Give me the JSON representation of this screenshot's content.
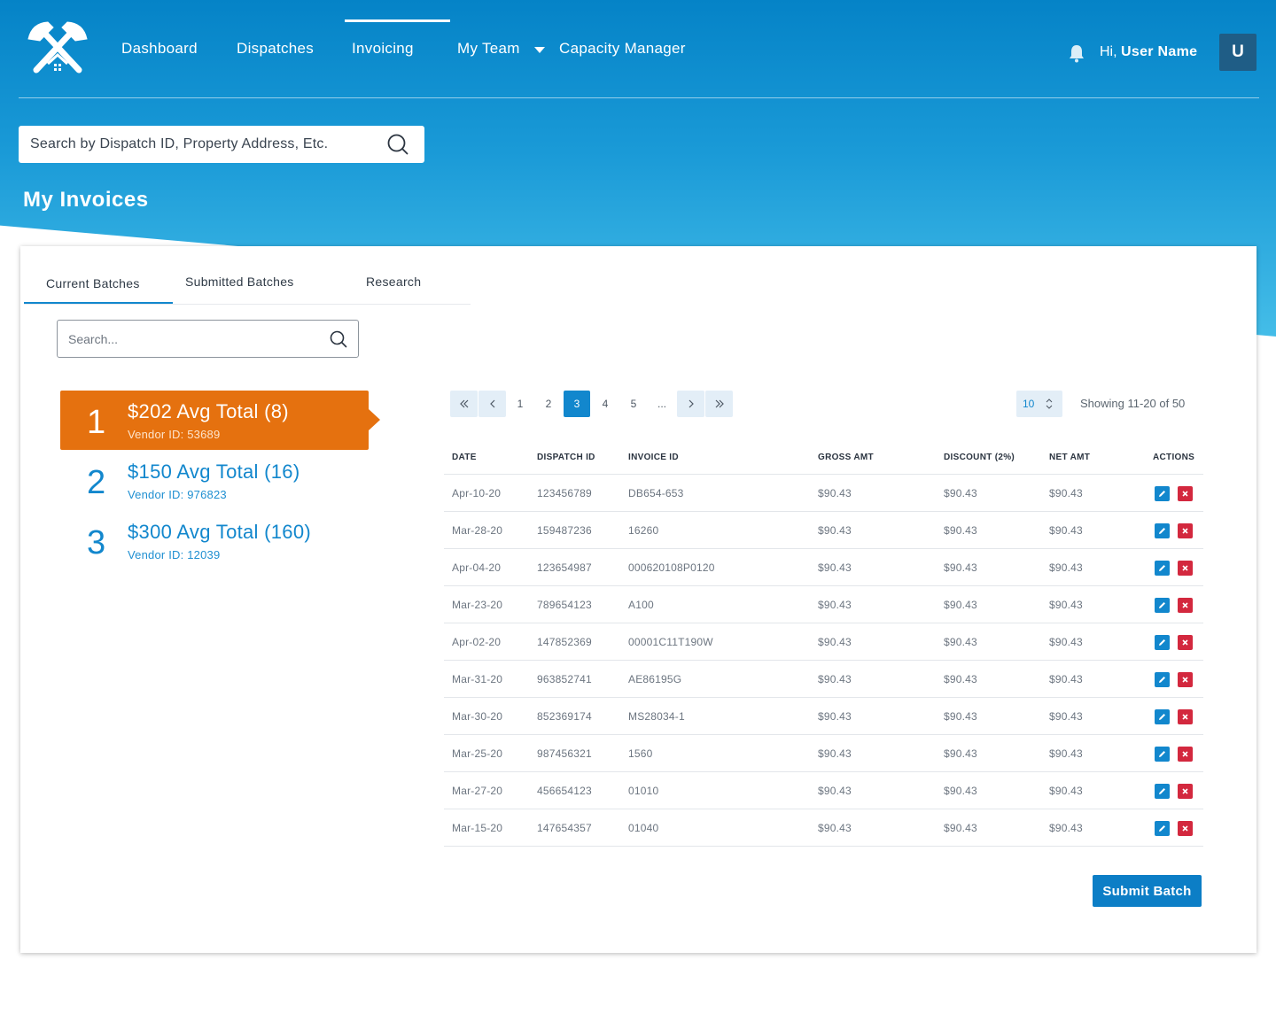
{
  "header": {
    "nav": [
      {
        "label": "Dashboard"
      },
      {
        "label": "Dispatches"
      },
      {
        "label": "Invoicing"
      },
      {
        "label": "My Team"
      },
      {
        "label": "Capacity Manager"
      }
    ],
    "active_nav": "Invoicing",
    "greeting_prefix": "Hi,",
    "user_name": "User Name",
    "avatar_initial": "U"
  },
  "global_search": {
    "placeholder": "Search by Dispatch ID, Property Address, Etc."
  },
  "page_title": "My Invoices",
  "tabs": [
    {
      "label": "Current Batches"
    },
    {
      "label": "Submitted Batches"
    },
    {
      "label": "Research"
    }
  ],
  "active_tab": "Current Batches",
  "batch_search": {
    "placeholder": "Search..."
  },
  "batches": [
    {
      "num": "1",
      "title": "$202 Avg Total (8)",
      "vendor": "Vendor ID: 53689"
    },
    {
      "num": "2",
      "title": "$150 Avg Total (16)",
      "vendor": "Vendor ID: 976823"
    },
    {
      "num": "3",
      "title": "$300 Avg Total (160)",
      "vendor": "Vendor ID: 12039"
    }
  ],
  "pagination": {
    "pages": [
      "1",
      "2",
      "3",
      "4",
      "5",
      "..."
    ],
    "current_page": "3",
    "page_size": "10",
    "showing": "Showing 11-20 of 50"
  },
  "table": {
    "headers": {
      "date": "DATE",
      "dispatch_id": "DISPATCH ID",
      "invoice_id": "INVOICE ID",
      "gross": "GROSS AMT",
      "discount": "DISCOUNT (2%)",
      "net": "NET AMT",
      "actions": "ACTIONS"
    },
    "rows": [
      {
        "date": "Apr-10-20",
        "dispatch": "123456789",
        "invoice": "DB654-653",
        "gross": "$90.43",
        "discount": "$90.43",
        "net": "$90.43"
      },
      {
        "date": "Mar-28-20",
        "dispatch": "159487236",
        "invoice": "16260",
        "gross": "$90.43",
        "discount": "$90.43",
        "net": "$90.43"
      },
      {
        "date": "Apr-04-20",
        "dispatch": "123654987",
        "invoice": "000620108P0120",
        "gross": "$90.43",
        "discount": "$90.43",
        "net": "$90.43"
      },
      {
        "date": "Mar-23-20",
        "dispatch": "789654123",
        "invoice": "A100",
        "gross": "$90.43",
        "discount": "$90.43",
        "net": "$90.43"
      },
      {
        "date": "Apr-02-20",
        "dispatch": "147852369",
        "invoice": "00001C11T190W",
        "gross": "$90.43",
        "discount": "$90.43",
        "net": "$90.43"
      },
      {
        "date": "Mar-31-20",
        "dispatch": "963852741",
        "invoice": "AE86195G",
        "gross": "$90.43",
        "discount": "$90.43",
        "net": "$90.43"
      },
      {
        "date": "Mar-30-20",
        "dispatch": "852369174",
        "invoice": "MS28034-1",
        "gross": "$90.43",
        "discount": "$90.43",
        "net": "$90.43"
      },
      {
        "date": "Mar-25-20",
        "dispatch": "987456321",
        "invoice": "1560",
        "gross": "$90.43",
        "discount": "$90.43",
        "net": "$90.43"
      },
      {
        "date": "Mar-27-20",
        "dispatch": "456654123",
        "invoice": "01010",
        "gross": "$90.43",
        "discount": "$90.43",
        "net": "$90.43"
      },
      {
        "date": "Mar-15-20",
        "dispatch": "147654357",
        "invoice": "01040",
        "gross": "$90.43",
        "discount": "$90.43",
        "net": "$90.43"
      }
    ]
  },
  "submit_label": "Submit Batch",
  "icons": {
    "logo": "hammers-house-logo-icon",
    "bell": "bell-icon",
    "search": "search-icon",
    "edit": "pencil-icon",
    "delete": "close-icon"
  },
  "colors": {
    "primary": "#1287cd",
    "accent_orange": "#e5710f",
    "danger": "#d3283e",
    "header_top": "#0583c7",
    "header_bottom": "#44bde8"
  }
}
